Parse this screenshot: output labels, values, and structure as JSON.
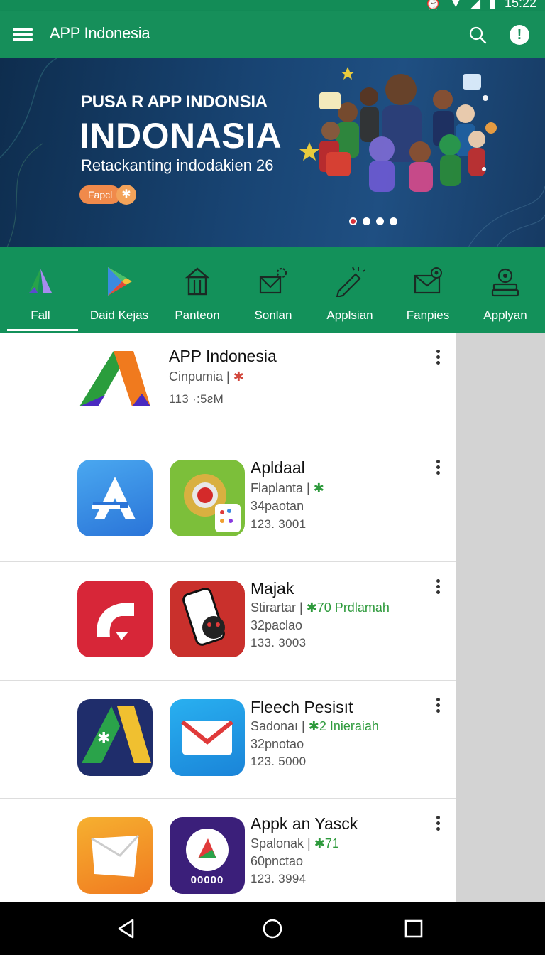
{
  "status_bar": {
    "time": "15:22"
  },
  "app_bar": {
    "title": "APP Indonesia"
  },
  "banner": {
    "subtitle": "PUSA R APP INDONSIA",
    "title": "INDONASIA",
    "tagline": "Retackanting indodakien 26",
    "chip_label": "Fapcl",
    "slide_count": 4,
    "active_slide": 0
  },
  "categories": [
    {
      "label": "Fall",
      "icon": "app-logo-icon",
      "selected": true
    },
    {
      "label": "Daid Kejas",
      "icon": "play-store-icon",
      "selected": false
    },
    {
      "label": "Panteon",
      "icon": "building-icon",
      "selected": false
    },
    {
      "label": "Sonlan",
      "icon": "mail-gear-icon",
      "selected": false
    },
    {
      "label": "Applsian",
      "icon": "pen-sparkle-icon",
      "selected": false
    },
    {
      "label": "Fanpies",
      "icon": "mail-badge-icon",
      "selected": false
    },
    {
      "label": "Applyan",
      "icon": "location-pin-icon",
      "selected": false
    }
  ],
  "apps": [
    {
      "title": "APP Indonesia",
      "meta": "Cinpumia |",
      "tag": "✱",
      "numbers": "113 ·:5ƨM"
    },
    {
      "title": "Apldaal",
      "meta": "Flaplanta |",
      "tag": "✱",
      "line2": "34paotan",
      "numbers": "123. 3001"
    },
    {
      "title": "Majak",
      "meta": "Stirartar |",
      "tag": "✱70 Prdlamah",
      "line2": "32paclao",
      "numbers": "133. 3003"
    },
    {
      "title": "Fleech Pesisıt",
      "meta": "Sadonaı |",
      "tag": "✱2 Inieraiah",
      "line2": "32pnotao",
      "numbers": "123. 5000"
    },
    {
      "title": "Appk an Yasck",
      "meta": "Spalonak |",
      "tag": "✱71",
      "line2": "60pnctao",
      "numbers": "123. 3994",
      "badge": "00000"
    }
  ],
  "colors": {
    "primary": "#168f5a",
    "banner": "#184473",
    "accent": "#f08a4b",
    "tag_green": "#2e9a3c"
  }
}
